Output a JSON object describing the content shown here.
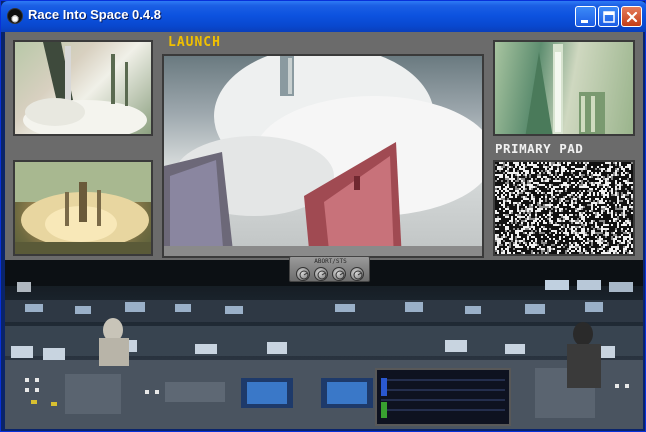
{
  "window": {
    "title": "Race Into Space 0.4.8",
    "icon": "race-into-space-app-icon",
    "controls": {
      "minimize_icon": "minimize-icon",
      "maximize_icon": "maximize-icon",
      "close_icon": "close-icon"
    }
  },
  "monitors": {
    "main_label": "LAUNCH",
    "pad_label": "PRIMARY PAD"
  },
  "control_panel": {
    "title": "ABORT/STS",
    "buttons": [
      "control-button-1",
      "control-button-2",
      "control-button-3",
      "control-button-4"
    ]
  },
  "colors": {
    "titlebar_blue": "#0d53e0",
    "launch_label": "#f0c000",
    "pad_label": "#f0f0f0",
    "panel_gray": "#6b6b6b"
  }
}
